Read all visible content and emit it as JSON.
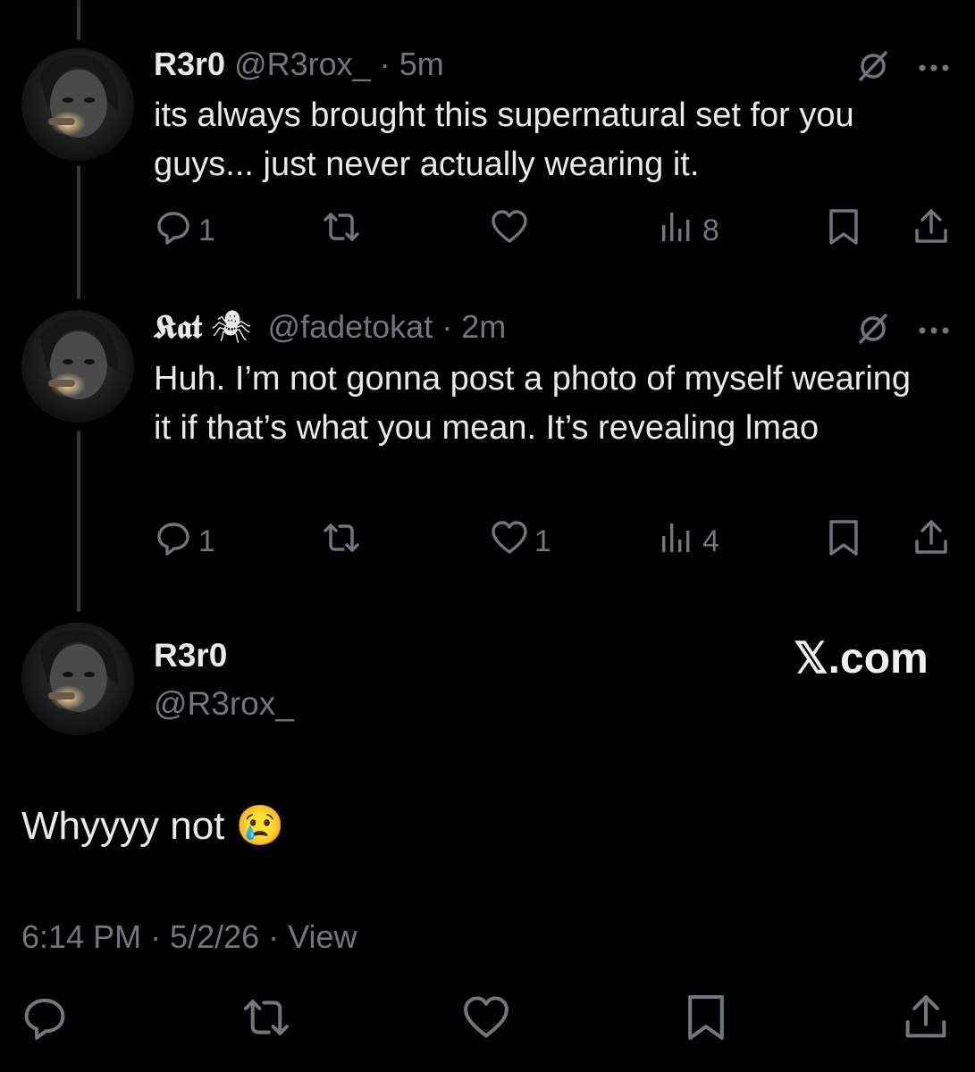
{
  "thread": [
    {
      "name": "R3r0",
      "handle": "@R3rox_",
      "time": "· 5m",
      "text": "its always brought this supernatural set for you guys... just never actually wearing it.",
      "replies": "1",
      "reposts": "",
      "likes": "",
      "views": "8"
    },
    {
      "name": "𝕶𝖆𝖙",
      "name_emoji": "🕷",
      "handle": "@fadetokat",
      "time": "· 2m",
      "text": "Huh. I’m not gonna post a photo of myself wearing it if that’s what you mean. It’s revealing lmao",
      "replies": "1",
      "reposts": "",
      "likes": "1",
      "views": "4"
    }
  ],
  "main_post": {
    "name": "R3r0",
    "handle": "@R3rox_",
    "text": "Whyyyy not 😢",
    "meta": "6:14 PM · 5/2/26 · View",
    "watermark": "𝕏.com"
  },
  "colors": {
    "background": "#000000",
    "text": "#e7e9ea",
    "muted": "#71767b",
    "thread_line": "#333639"
  },
  "icons": [
    "reply-icon",
    "repost-icon",
    "like-icon",
    "views-icon",
    "bookmark-icon",
    "share-icon",
    "grok-icon",
    "more-icon"
  ]
}
